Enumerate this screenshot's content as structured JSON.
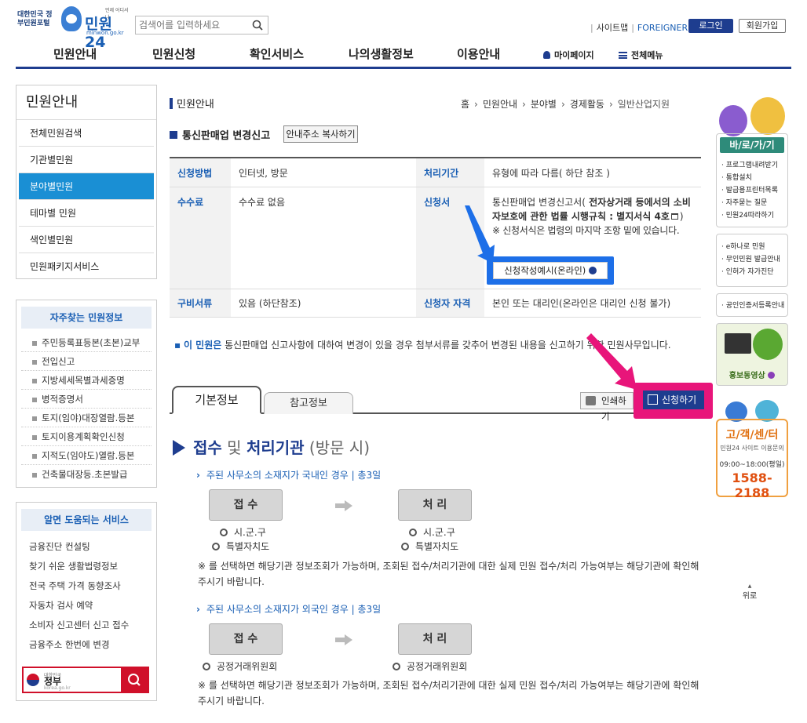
{
  "header": {
    "gov_logo": "대한민국 정부민원포털",
    "brand": "민원24",
    "brand_sub": "minwon.go.kr",
    "brand_tag": "언제 어디서나",
    "search_placeholder": "검색어를 입력하세요",
    "top_links": [
      "사이트맵",
      "FOREIGNER"
    ],
    "login": "로그인",
    "join": "회원가입"
  },
  "gnb": {
    "items": [
      "민원안내",
      "민원신청",
      "확인서비스",
      "나의생활정보",
      "이용안내"
    ],
    "mypage": "마이페이지",
    "allmenu": "전체메뉴"
  },
  "lnb": {
    "title": "민원안내",
    "items": [
      "전체민원검색",
      "기관별민원",
      "분야별민원",
      "테마별 민원",
      "색인별민원",
      "민원패키지서비스"
    ]
  },
  "fav": {
    "title": "자주찾는 민원정보",
    "items": [
      "주민등록표등본(초본)교부",
      "전입신고",
      "지방세세목별과세증명",
      "병적증명서",
      "토지(임야)대장열람.등본",
      "토지이용계획확인신청",
      "지적도(임야도)열람.등본",
      "건축물대장등.초본발급"
    ]
  },
  "help": {
    "title": "알면 도움되는 서비스",
    "items": [
      "금융진단 컨설팅",
      "찾기 쉬운 생활법령정보",
      "전국 주택 가격 동향조사",
      "자동차 검사 예약",
      "소비자 신고센터 신고 접수",
      "금융주소 한번에 변경"
    ],
    "gov_small": "대한민국",
    "gov_label": "정부",
    "gov_url": "korea.go.kr"
  },
  "content": {
    "crumb_title": "민원안내",
    "breadcrumb": [
      "홈",
      "민원안내",
      "분야별",
      "경제활동",
      "일반산업지원"
    ],
    "svc_title": "통신판매업 변경신고",
    "copy_btn": "안내주소 복사하기",
    "table": {
      "method_label": "신청방법",
      "method": "인터넷, 방문",
      "period_label": "처리기간",
      "period": "유형에 따라 다름( 하단 참조 )",
      "fee_label": "수수료",
      "fee": "수수료 없음",
      "form_label": "신청서",
      "form_prefix": "통신판매업 변경신고서(",
      "form_law": " 전자상거래 등에서의 소비자보호에 관한 법률 시행규칙 : 별지서식 4호",
      "form_suffix": ")",
      "form_note": "※ 신청서식은 법령의 마지막 조항 밑에 있습니다.",
      "form_example": "신청작성예시(온라인)",
      "docs_label": "구비서류",
      "docs": "있음 (하단참조)",
      "qual_label": "신청자 자격",
      "qual": "본인 또는 대리인(온라인은 대리인 신청 불가)"
    },
    "desc_label": "이 민원은",
    "desc_text": " 통신판매업 신고사항에 대하여 변경이 있을 경우 첨부서류를 갖추어 변경된 내용을 신고하기 위한 민원사무입니다.",
    "tabs": [
      "기본정보",
      "참고정보"
    ],
    "print": "인쇄하기",
    "apply": "신청하기",
    "sec_title": {
      "a": "접수",
      "b": " 및 ",
      "c": "처리기관",
      "d": " (방문 시)"
    },
    "block1": {
      "heading": "주된 사무소의 소재지가 국내인 경우 | 총3일",
      "recv": "접 수",
      "proc": "처 리",
      "recv_orgs": [
        "시.군.구",
        "특별자치도"
      ],
      "proc_orgs": [
        "시.군.구",
        "특별자치도"
      ],
      "note": "※ 를 선택하면 해당기관 정보조회가 가능하며, 조회된 접수/처리기관에 대한 실제 민원 접수/처리 가능여부는 해당기관에 확인해 주시기 바랍니다."
    },
    "block2": {
      "heading": "주된 사무소의 소재지가 외국인 경우 | 총3일",
      "recv": "접 수",
      "proc": "처 리",
      "recv_orgs": [
        "공정거래위원회"
      ],
      "proc_orgs": [
        "공정거래위원회"
      ],
      "note": "※ 를 선택하면 해당기관 정보조회가 가능하며, 조회된 접수/처리기관에 대한 실제 민원 접수/처리 가능여부는 해당기관에 확인해 주시기 바랍니다."
    }
  },
  "quick": {
    "go_title": "바/로/가/기",
    "go_items": [
      "프로그램내려받기",
      "통합설치",
      "발급용프린터목록",
      "자주묻는 질문",
      "민원24따라하기"
    ],
    "e_items": [
      "e하나로 민원",
      "무인민원 발급안내",
      "인허가 자가진단"
    ],
    "cert": "공인인증서등록안내",
    "video": "홍보동영상",
    "cs_title": "고/객/센/터",
    "cs_sub": "민원24 사이트 이용문의",
    "cs_hours": "09:00~18:00(평일)",
    "cs_phone": "1588-2188",
    "top": "위로"
  },
  "colors": {
    "primary": "#1e3d8f",
    "active": "#1a8fd4",
    "callout_blue": "#1d6fe8",
    "callout_pink": "#e8157a"
  }
}
